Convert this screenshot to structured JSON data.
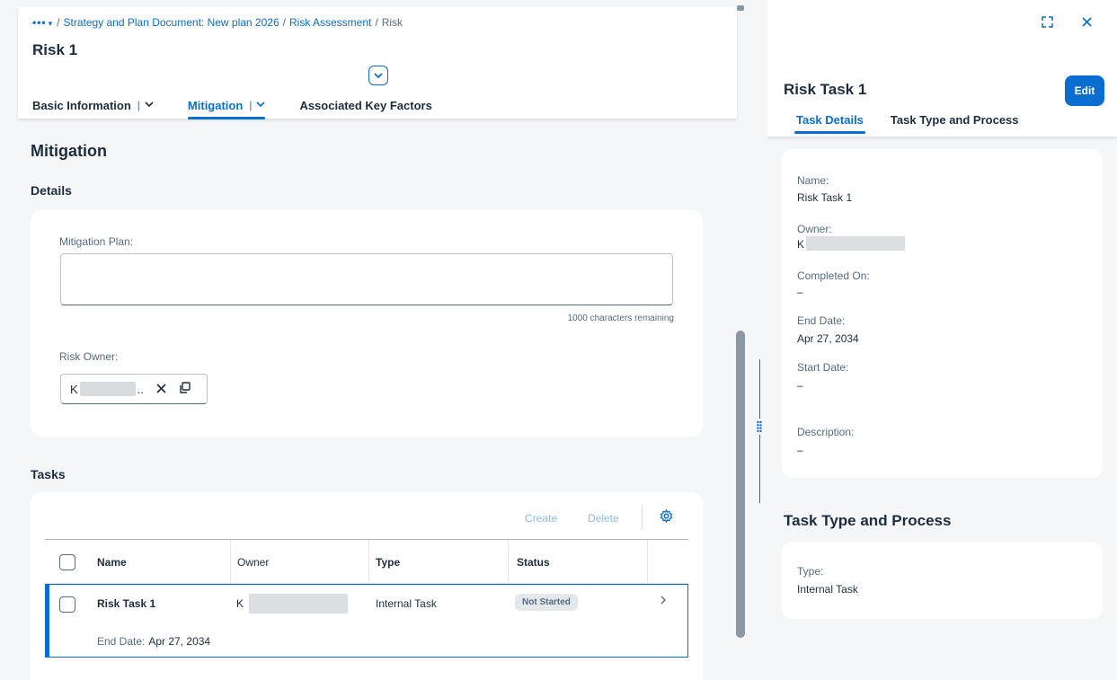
{
  "breadcrumb": {
    "more": "•••",
    "items": [
      "Strategy and Plan Document: New plan 2026",
      "Risk Assessment",
      "Risk"
    ]
  },
  "object": {
    "title": "Risk 1",
    "tabs": [
      {
        "label": "Basic Information",
        "active": false,
        "has_menu": true
      },
      {
        "label": "Mitigation",
        "active": true,
        "has_menu": true
      },
      {
        "label": "Associated Key Factors",
        "active": false,
        "has_menu": false
      }
    ]
  },
  "mitigation": {
    "section_title": "Mitigation",
    "details_title": "Details",
    "plan_label": "Mitigation Plan:",
    "plan_value": "",
    "char_count": "1000 characters remaining",
    "owner_label": "Risk Owner:",
    "owner_initial": "K",
    "owner_ellipsis": ".."
  },
  "tasks": {
    "title": "Tasks",
    "create_label": "Create",
    "delete_label": "Delete",
    "columns": [
      "Name",
      "Owner",
      "Type",
      "Status"
    ],
    "rows": [
      {
        "name": "Risk Task 1",
        "owner_initial": "K",
        "type": "Internal Task",
        "status": "Not Started",
        "end_date_label": "End Date:",
        "end_date": "Apr 27, 2034"
      }
    ]
  },
  "detail_panel": {
    "title": "Risk Task 1",
    "edit_label": "Edit",
    "tabs": [
      {
        "label": "Task Details",
        "active": true
      },
      {
        "label": "Task Type and Process",
        "active": false
      }
    ],
    "fields": {
      "name_label": "Name:",
      "name_value": "Risk Task 1",
      "owner_label": "Owner:",
      "owner_initial": "K",
      "completed_label": "Completed On:",
      "completed_value": "–",
      "end_label": "End Date:",
      "end_value": "Apr 27, 2034",
      "start_label": "Start Date:",
      "start_value": "–",
      "description_label": "Description:",
      "description_value": "–"
    },
    "section_title": "Task Type and Process",
    "type_label": "Type:",
    "type_value": "Internal Task"
  },
  "colors": {
    "accent": "#0a6ed1",
    "text": "#1d2d3e",
    "muted": "#556b82",
    "background": "#f5f6f7"
  },
  "icons": {
    "breadcrumb_more": "chevron-down-icon",
    "collapse_header": "chevron-down-icon",
    "clear": "close-icon",
    "value_help": "copy-icon",
    "table_settings": "gear-icon",
    "row_navigation": "chevron-right-icon",
    "fullscreen": "fullscreen-icon",
    "close_panel": "close-icon",
    "splitter": "grip-icon"
  }
}
